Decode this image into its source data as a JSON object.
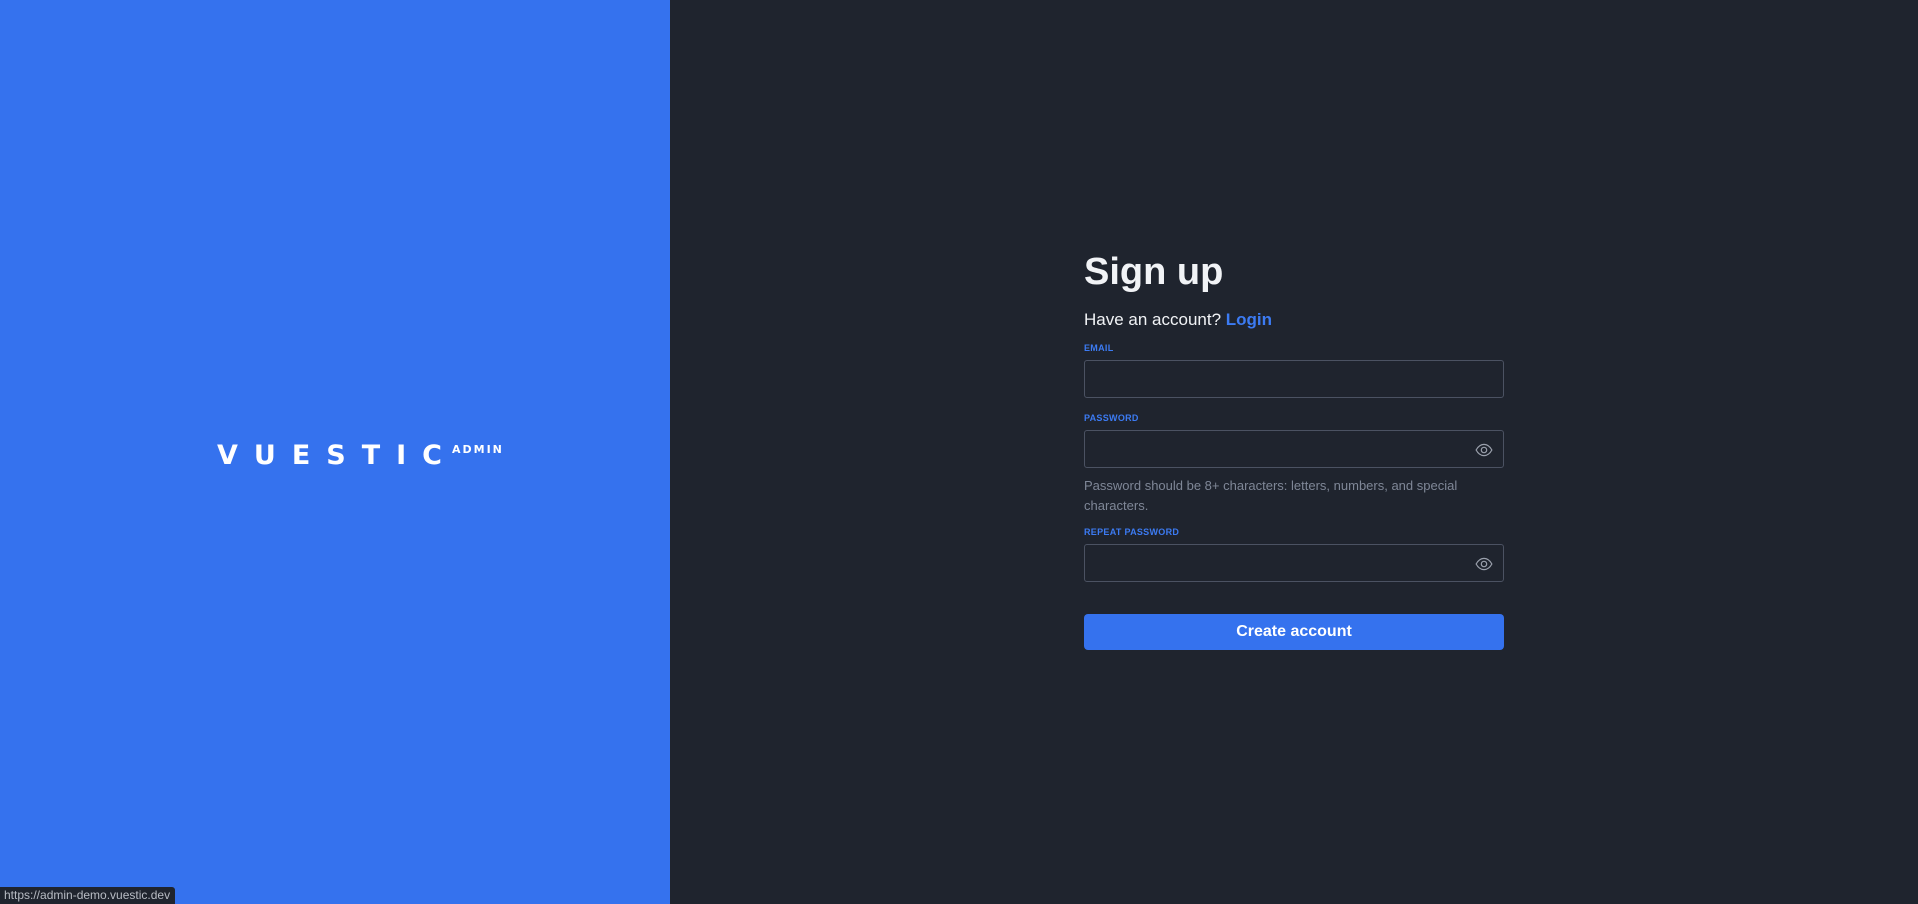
{
  "brand": {
    "logo_main": "VUESTIC",
    "logo_sub": "ADMIN"
  },
  "form": {
    "title": "Sign up",
    "have_account_text": "Have an account?",
    "login_link": "Login",
    "email": {
      "label": "EMAIL",
      "value": ""
    },
    "password": {
      "label": "PASSWORD",
      "value": "",
      "hint": "Password should be 8+ characters: letters, numbers, and special characters.",
      "toggle_icon": "eye-icon"
    },
    "repeat_password": {
      "label": "REPEAT PASSWORD",
      "value": "",
      "toggle_icon": "eye-icon"
    },
    "submit_label": "Create account"
  },
  "status_bar": {
    "url": "https://admin-demo.vuestic.dev"
  },
  "colors": {
    "brand_blue": "#3572EE",
    "dark_background": "#1F242E",
    "link_blue": "#3C7BF3",
    "hint_gray": "#7F8797"
  }
}
